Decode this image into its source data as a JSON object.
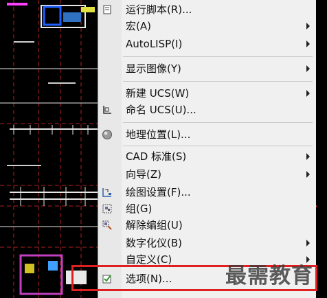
{
  "menu": {
    "items": [
      {
        "label": "运行脚本(R)...",
        "icon": "script-icon",
        "submenu": false
      },
      {
        "label": "宏(A)",
        "icon": "",
        "submenu": true
      },
      {
        "label": "AutoLISP(I)",
        "icon": "",
        "submenu": true
      },
      {
        "label": "显示图像(Y)",
        "icon": "",
        "submenu": true
      },
      {
        "label": "新建 UCS(W)",
        "icon": "",
        "submenu": true
      },
      {
        "label": "命名 UCS(U)...",
        "icon": "ucs-icon",
        "submenu": false
      },
      {
        "label": "地理位置(L)...",
        "icon": "globe-icon",
        "submenu": false
      },
      {
        "label": "CAD 标准(S)",
        "icon": "",
        "submenu": true
      },
      {
        "label": "向导(Z)",
        "icon": "",
        "submenu": true
      },
      {
        "label": "绘图设置(F)...",
        "icon": "drafting-settings-icon",
        "submenu": false
      },
      {
        "label": "组(G)",
        "icon": "group-icon",
        "submenu": false
      },
      {
        "label": "解除编组(U)",
        "icon": "ungroup-icon",
        "submenu": false
      },
      {
        "label": "数字化仪(B)",
        "icon": "",
        "submenu": true
      },
      {
        "label": "自定义(C)",
        "icon": "",
        "submenu": true
      },
      {
        "label": "选项(N)...",
        "icon": "checkbox-options-icon",
        "submenu": false
      }
    ]
  },
  "watermark": "最需教育",
  "colors": {
    "menu_bg": "#f0f0f0",
    "highlight": "#e02020",
    "arrow_annotation": "#e8362a",
    "cad_background": "#000000"
  }
}
